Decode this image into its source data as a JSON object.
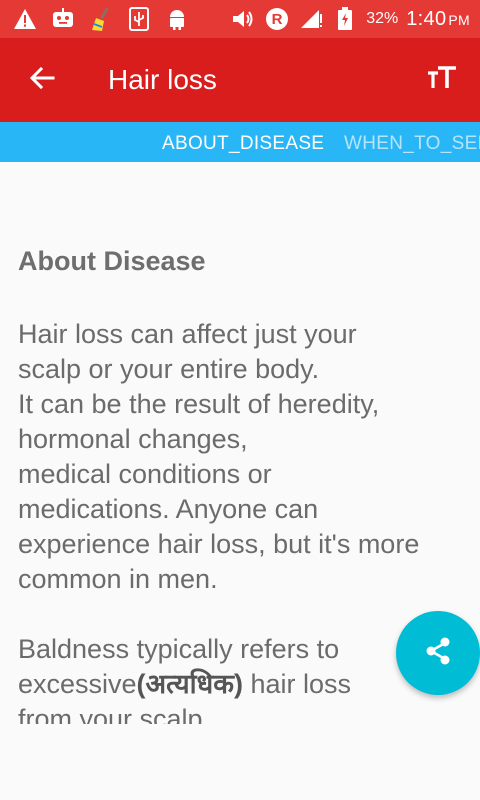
{
  "status_bar": {
    "battery_percent": "32%",
    "time": "1:40",
    "ampm": "PM",
    "icons": [
      "warning-icon",
      "chat-bot-icon",
      "broom-icon",
      "usb-icon",
      "android-icon",
      "volume-icon",
      "roaming-r-icon",
      "signal-icon",
      "battery-icon"
    ]
  },
  "app_bar": {
    "title": "Hair loss",
    "back_icon": "arrow-back-icon",
    "text_size_icon": "text-size-icon"
  },
  "tabs": [
    {
      "label": "ABOUT_DISEASE",
      "active": true
    },
    {
      "label": "WHEN_TO_SEE",
      "active": false
    }
  ],
  "content": {
    "heading": "About Disease",
    "para1": [
      "Hair loss can affect just your",
      "scalp or your entire body.",
      "It can be the result of heredity,",
      "hormonal changes,",
      "medical conditions or",
      "medications. Anyone can",
      "experience hair loss, but it's more",
      "common in men."
    ],
    "para2": {
      "line1": "Baldness typically refers to",
      "line2_before": "excessive",
      "line2_hindi": "(अत्यधिक)",
      "line2_after": " hair loss",
      "line3": "from your scalp."
    }
  },
  "fab": {
    "icon": "share-icon"
  },
  "colors": {
    "status_bar": "#e53935",
    "app_bar": "#d91d1d",
    "tab_bar": "#29b6f6",
    "fab": "#00bcd4",
    "body_text": "#6b6b6b"
  }
}
